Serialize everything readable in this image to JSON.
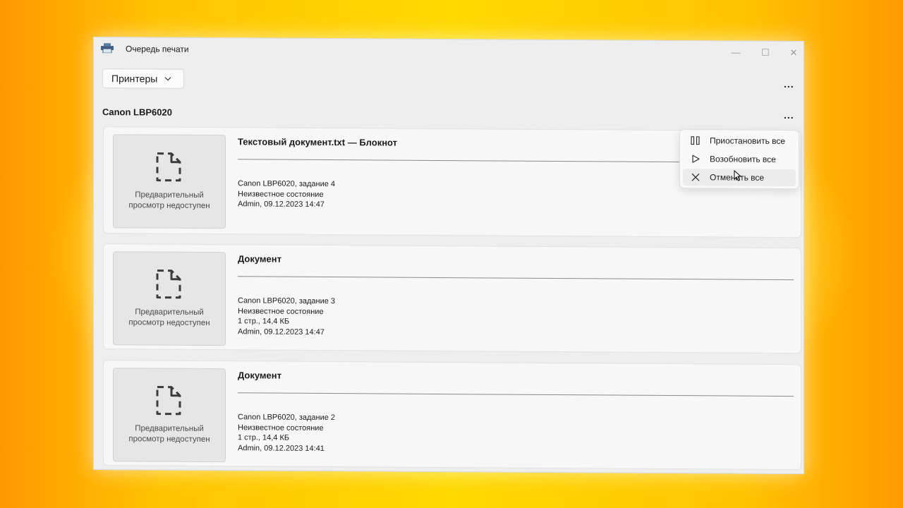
{
  "window": {
    "title": "Очередь печати",
    "controls": {
      "minimize": "—",
      "maximize": "☐",
      "close": "✕"
    }
  },
  "toolbar": {
    "printers_label": "Принтеры",
    "more": "..."
  },
  "printer": {
    "name": "Canon LBP6020",
    "more": "..."
  },
  "preview_unavailable": "Предварительный\nпросмотр недоступен",
  "jobs": [
    {
      "title": "Текстовый документ.txt — Блокнот",
      "task": "Canon LBP6020, задание 4",
      "status": "Неизвестное состояние",
      "owner_time": "Admin, 09.12.2023 14:47"
    },
    {
      "title": "Документ",
      "task": "Canon LBP6020, задание 3",
      "status": "Неизвестное состояние",
      "pages_size": "1 стр., 14,4 КБ",
      "owner_time": "Admin, 09.12.2023 14:47"
    },
    {
      "title": "Документ",
      "task": "Canon LBP6020, задание 2",
      "status": "Неизвестное состояние",
      "pages_size": "1 стр., 14,4 КБ",
      "owner_time": "Admin, 09.12.2023 14:41"
    }
  ],
  "context_menu": {
    "items": [
      {
        "label": "Приостановить все",
        "icon": "pause-icon"
      },
      {
        "label": "Возобновить все",
        "icon": "play-icon"
      },
      {
        "label": "Отменить все",
        "icon": "close-icon",
        "hovered": true
      }
    ]
  }
}
